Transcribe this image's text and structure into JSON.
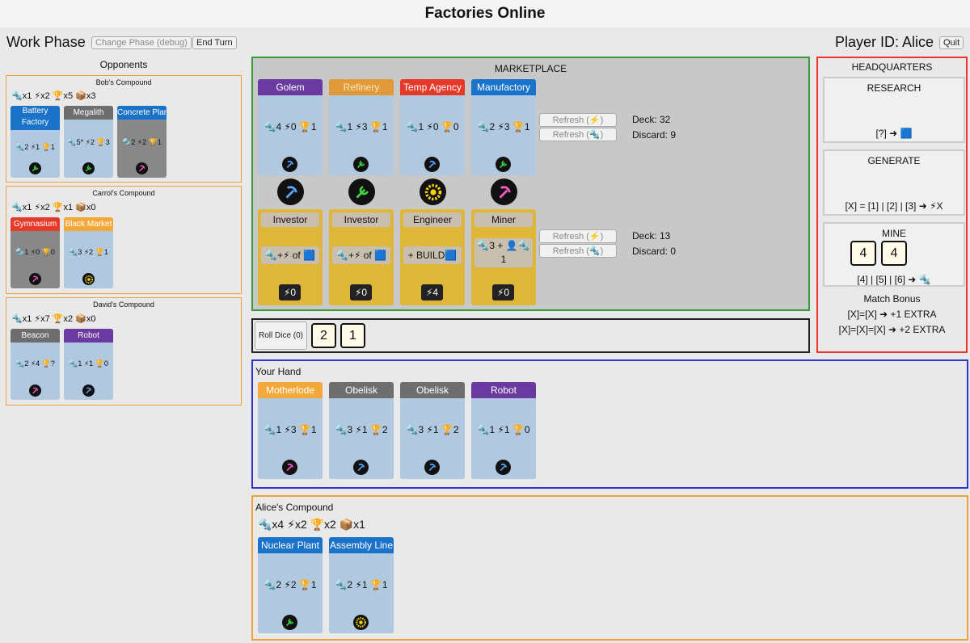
{
  "app_title": "Factories Online",
  "phase_label": "Work Phase",
  "change_phase_label": "Change Phase (debug)",
  "end_turn_label": "End Turn",
  "player_label": "Player ID: Alice",
  "quit_label": "Quit",
  "opponents_title": "Opponents",
  "colors": {
    "blue": "#1a73c8",
    "gray": "#6e6e6e",
    "red": "#e53a2b",
    "orange": "#f5a83a",
    "purple": "#6a3aa0",
    "ochre": "#e09a3a",
    "gold": "#deb63a"
  },
  "opponents": [
    {
      "name": "Bob's Compound",
      "resources": "🔩x1 ⚡x2 🏆x5 📦x3",
      "cards": [
        {
          "name": "Battery Factory",
          "stats": "🔩2 ⚡1 🏆1",
          "icon": "wrench-icon"
        },
        {
          "name": "Megalith",
          "stats": "🔩5* ⚡2 🏆3",
          "icon": "wrench-icon"
        },
        {
          "name": "Concrete Plant",
          "stats": "🔩2 ⚡2 🏆1",
          "icon": "pickaxe-icon"
        }
      ]
    },
    {
      "name": "Carrol's Compound",
      "resources": "🔩x1 ⚡x2 🏆x1 📦x0",
      "cards": [
        {
          "name": "Gymnasium",
          "stats": "🔩1 ⚡0 🏆0",
          "icon": "pickaxe-icon"
        },
        {
          "name": "Black Market",
          "stats": "🔩3 ⚡2 🏆1",
          "icon": "gear-icon"
        }
      ]
    },
    {
      "name": "David's Compound",
      "resources": "🔩x1 ⚡x7 🏆x2 📦x0",
      "cards": [
        {
          "name": "Beacon",
          "stats": "🔩2 ⚡4 🏆?",
          "icon": "pickaxe-icon"
        },
        {
          "name": "Robot",
          "stats": "🔩1 ⚡1 🏆0",
          "icon": "pickaxe-icon"
        }
      ]
    }
  ],
  "market": {
    "title": "MARKETPLACE",
    "factories": [
      {
        "name": "Golem",
        "stats": "🔩4 ⚡0 🏆1"
      },
      {
        "name": "Refinery",
        "stats": "🔩1 ⚡3 🏆1"
      },
      {
        "name": "Temp Agency",
        "stats": "🔩1 ⚡0 🏆0"
      },
      {
        "name": "Manufactory",
        "stats": "🔩2 ⚡3 🏆1"
      }
    ],
    "workers": [
      {
        "name": "Investor",
        "ability": "🔩+⚡ of 🟦",
        "cost": "⚡0"
      },
      {
        "name": "Investor",
        "ability": "🔩+⚡ of 🟦",
        "cost": "⚡0"
      },
      {
        "name": "Engineer",
        "ability": "+ BUILD🟦",
        "cost": "⚡4"
      },
      {
        "name": "Miner",
        "ability": "🔩3 + 👤🔩 1",
        "cost": "⚡0"
      }
    ],
    "refresh_energy": "Refresh (⚡)",
    "refresh_parts": "Refresh (🔩)",
    "factory_deck": "Deck: 32",
    "factory_discard": "Discard: 9",
    "worker_deck": "Deck: 13",
    "worker_discard": "Discard: 0"
  },
  "dice": {
    "roll_label": "Roll Dice (0)",
    "values": [
      "2",
      "1"
    ]
  },
  "hand": {
    "title": "Your Hand",
    "cards": [
      {
        "name": "Motherlode",
        "stats": "🔩1 ⚡3 🏆1"
      },
      {
        "name": "Obelisk",
        "stats": "🔩3 ⚡1 🏆2"
      },
      {
        "name": "Obelisk",
        "stats": "🔩3 ⚡1 🏆2"
      },
      {
        "name": "Robot",
        "stats": "🔩1 ⚡1 🏆0"
      }
    ]
  },
  "alice": {
    "title": "Alice's Compound",
    "resources": "🔩x4 ⚡x2 🏆x2 📦x1",
    "cards": [
      {
        "name": "Nuclear Plant",
        "stats": "🔩2 ⚡2 🏆1"
      },
      {
        "name": "Assembly Line",
        "stats": "🔩2 ⚡1 🏆1"
      }
    ]
  },
  "hq": {
    "title": "HEADQUARTERS",
    "research_label": "RESEARCH",
    "research_rule": "[?] ➜ 🟦",
    "generate_label": "GENERATE",
    "generate_rule": "[X] = [1] | [2] | [3] ➜ ⚡X",
    "mine_label": "MINE",
    "mine_dice": [
      "4",
      "4"
    ],
    "mine_rule": "[4] | [5] | [6] ➜ 🔩",
    "match_title": "Match Bonus",
    "match_1": "[X]=[X] ➜ +1 EXTRA",
    "match_2": "[X]=[X]=[X] ➜ +2 EXTRA"
  }
}
